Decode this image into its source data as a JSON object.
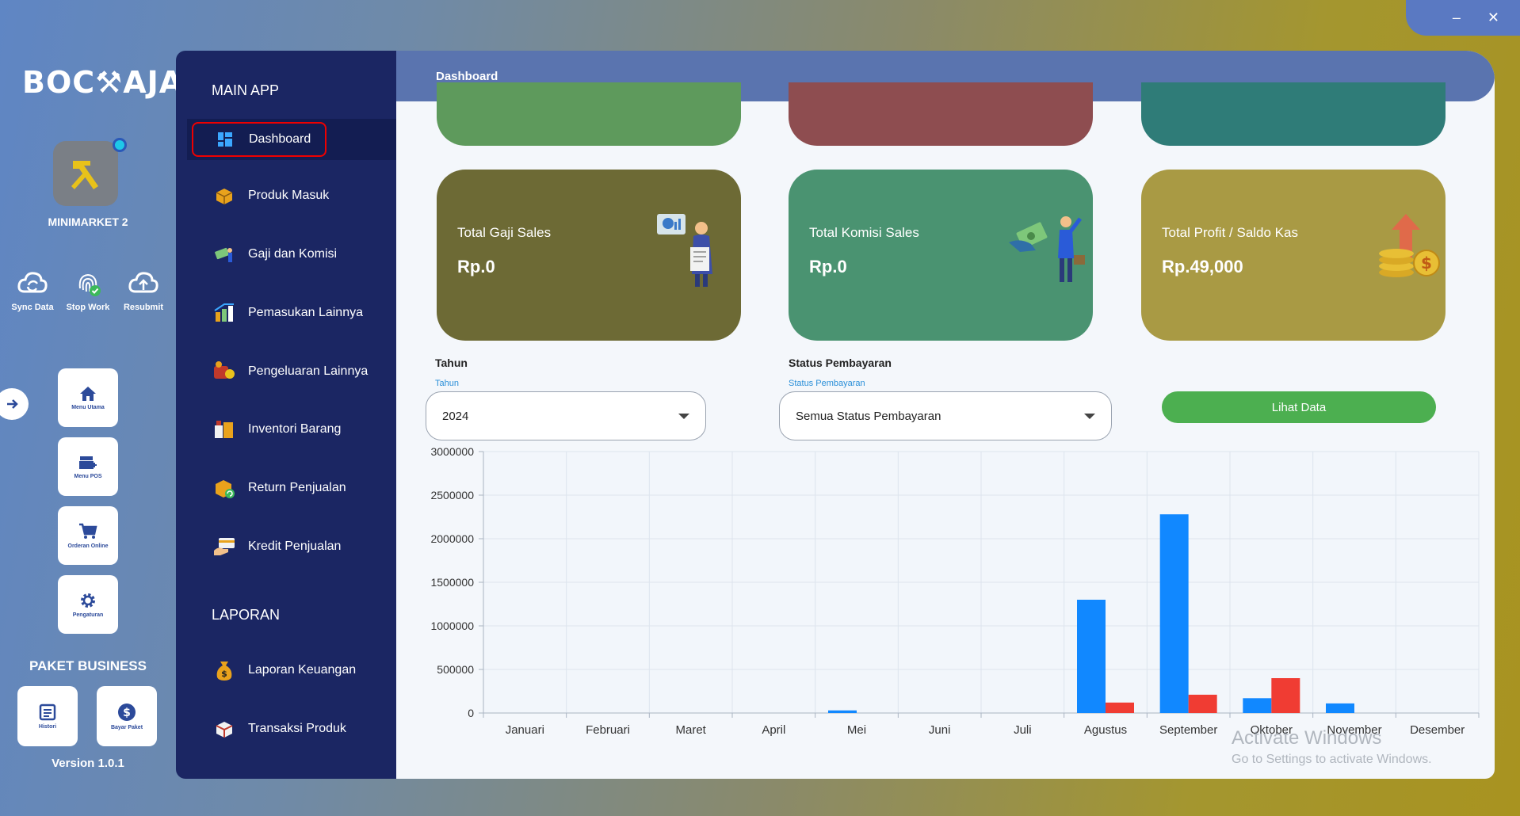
{
  "window": {
    "minimize_label": "–",
    "close_label": "✕"
  },
  "rail": {
    "logo_text": "BOC⚒AJA",
    "store_name": "MINIMARKET 2",
    "quick_actions": [
      {
        "label": "Sync Data",
        "icon": "sync-cloud-icon"
      },
      {
        "label": "Stop Work",
        "icon": "fingerprint-icon"
      },
      {
        "label": "Resubmit",
        "icon": "upload-cloud-icon"
      }
    ],
    "menu": [
      {
        "label": "Menu Utama",
        "icon": "home-icon"
      },
      {
        "label": "Menu POS",
        "icon": "pos-icon"
      },
      {
        "label": "Orderan Online",
        "icon": "cart-icon"
      },
      {
        "label": "Pengaturan",
        "icon": "gear-icon"
      }
    ],
    "paket_title": "PAKET BUSINESS",
    "paket_buttons": [
      {
        "label": "Histori",
        "icon": "history-icon"
      },
      {
        "label": "Bayar Paket",
        "icon": "dollar-icon"
      }
    ],
    "version": "Version 1.0.1"
  },
  "sidebar": {
    "section_main": "MAIN APP",
    "main_items": [
      {
        "label": "Dashboard",
        "icon": "dashboard-icon"
      },
      {
        "label": "Produk Masuk",
        "icon": "box-icon"
      },
      {
        "label": "Gaji dan Komisi",
        "icon": "salary-icon"
      },
      {
        "label": "Pemasukan Lainnya",
        "icon": "income-icon"
      },
      {
        "label": "Pengeluaran Lainnya",
        "icon": "expense-icon"
      },
      {
        "label": "Inventori Barang",
        "icon": "inventory-icon"
      },
      {
        "label": "Return Penjualan",
        "icon": "return-icon"
      },
      {
        "label": "Kredit Penjualan",
        "icon": "credit-card-icon"
      }
    ],
    "section_report": "LAPORAN",
    "report_items": [
      {
        "label": "Laporan Keuangan",
        "icon": "money-bag-icon"
      },
      {
        "label": "Transaksi Produk",
        "icon": "package-icon"
      }
    ]
  },
  "header": {
    "title": "Dashboard"
  },
  "cards": [
    {
      "label": "Total Gaji Sales",
      "value": "Rp.0",
      "color": "#6d6a35"
    },
    {
      "label": "Total Komisi Sales",
      "value": "Rp.0",
      "color": "#4a9371"
    },
    {
      "label": "Total Profit / Saldo Kas",
      "value": "Rp.49,000",
      "color": "#a99a44"
    }
  ],
  "top_card_colors": [
    "#5e9a5c",
    "#8e4d50",
    "#2f7c78"
  ],
  "filters": {
    "tahun_label": "Tahun",
    "tahun_small": "Tahun",
    "tahun_value": "2024",
    "status_label": "Status Pembayaran",
    "status_small": "Status Pembayaran",
    "status_value": "Semua Status Pembayaran",
    "lihat_button": "Lihat Data"
  },
  "chart_data": {
    "type": "bar",
    "categories": [
      "Januari",
      "Februari",
      "Maret",
      "April",
      "Mei",
      "Juni",
      "Juli",
      "Agustus",
      "September",
      "Oktober",
      "November",
      "Desember"
    ],
    "series": [
      {
        "values": [
          0,
          0,
          0,
          0,
          30000,
          0,
          0,
          1300000,
          2280000,
          170000,
          110000,
          0
        ],
        "color": "#1188ff"
      },
      {
        "values": [
          0,
          0,
          0,
          0,
          0,
          0,
          0,
          120000,
          210000,
          400000,
          0,
          0
        ],
        "color": "#f03c33"
      }
    ],
    "yticks": [
      0,
      500000,
      1000000,
      1500000,
      2000000,
      2500000,
      3000000
    ],
    "ylim": [
      0,
      3000000
    ],
    "grid": true
  },
  "watermark": {
    "line1": "Activate Windows",
    "line2": "Go to Settings to activate Windows."
  }
}
